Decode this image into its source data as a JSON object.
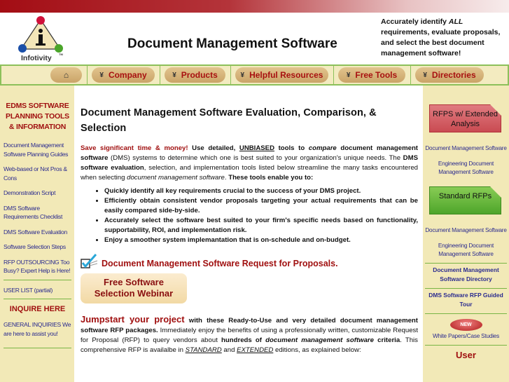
{
  "header": {
    "logo_text": "Infotivity",
    "logo_tm": "TM",
    "site_title": "Document Management Software",
    "tagline_prefix": "Accurately identify ",
    "tagline_all": "ALL",
    "tagline_suffix": " requirements, evaluate proposals, and select the best document management software!"
  },
  "nav": {
    "home_icon": "home-icon",
    "items": [
      {
        "label": "Company"
      },
      {
        "label": "Products"
      },
      {
        "label": "Helpful Resources"
      },
      {
        "label": "Free Tools"
      },
      {
        "label": "Directories"
      }
    ]
  },
  "left_sidebar": {
    "section_title": "EDMS SOFTWARE PLANNING TOOLS & INFORMATION",
    "links": [
      "Document Management Software Planning Guides",
      "Web-based or Not Pros & Cons",
      "Demonstration Script",
      "DMS Software Requirements Checklist",
      "DMS Software Evaluation",
      "Software Selection Steps",
      "RFP OUTSOURCING Too Busy? Expert Help is Here!"
    ],
    "user_list": "USER LIST (partial)",
    "inquire_title": "INQUIRE HERE",
    "general_inquiries": "GENERAL INQUIRIES We are here to assist you!"
  },
  "main": {
    "title": "Document Management Software Evaluation, Comparison, & Selection",
    "intro": {
      "save": "Save significant time & money!",
      "use_detailed": " Use detailed, ",
      "unbiased": "UNBIASED",
      "tools_to": " tools to ",
      "compare": "compare",
      "dms_software": " document management software",
      "rest1": " (DMS) systems to determine which one is best suited to your organization's unique needs. The ",
      "dms_eval": "DMS software evaluation",
      "rest2": ", selection, and implementation tools listed below streamline the many tasks encountered when selecting ",
      "dms_italic": "document management software",
      "rest3": ". ",
      "enable": "These tools enable you to:"
    },
    "bullets": [
      "Quickly identify all key requirements crucial to the success of your DMS project.",
      "Efficiently obtain consistent vendor proposals targeting your actual requirements that can be easily compared side-by-side.",
      "Accurately select the software best suited to your firm's specific needs based on functionality, supportability, ROI, and implementation risk.",
      "Enjoy a smoother system implemantation that is on-schedule and on-budget."
    ],
    "rfp_heading": "Document Management Software Request for Proposals.",
    "webinar_line1": "Free Software",
    "webinar_line2": "Selection Webinar",
    "jump": {
      "big": "Jumpstart your project",
      "bold1": " with these Ready-to-Use and very detailed document management software RFP packages.",
      "text1": "  Immediately enjoy the benefits of using a professionally written, customizable Request for Proposal (RFP) to query vendors about ",
      "bold2": "hundreds of ",
      "bolditalic": "document management software",
      "bold3": " criteria",
      "text2": ". This comprehensive RFP is availalbe in ",
      "standard": "STANDARD",
      "and": " and ",
      "extended": "EXTENDED",
      "text3": " editions, as explained below:"
    }
  },
  "right_sidebar": {
    "extended_folder": "RFPS w/ Extended Analysis",
    "extended_links": [
      "Document Management Software",
      "Engineering Document Management Software"
    ],
    "standard_folder": "Standard RFPs",
    "standard_links": [
      "Document Management Software",
      "Engineering Document Management Software"
    ],
    "directory_link": "Document Management Software Directory",
    "guided_tour": "DMS Software RFP Guided Tour",
    "new_badge": "NEW",
    "white_papers": "White Papers/Case Studies",
    "user_heading": "User"
  }
}
